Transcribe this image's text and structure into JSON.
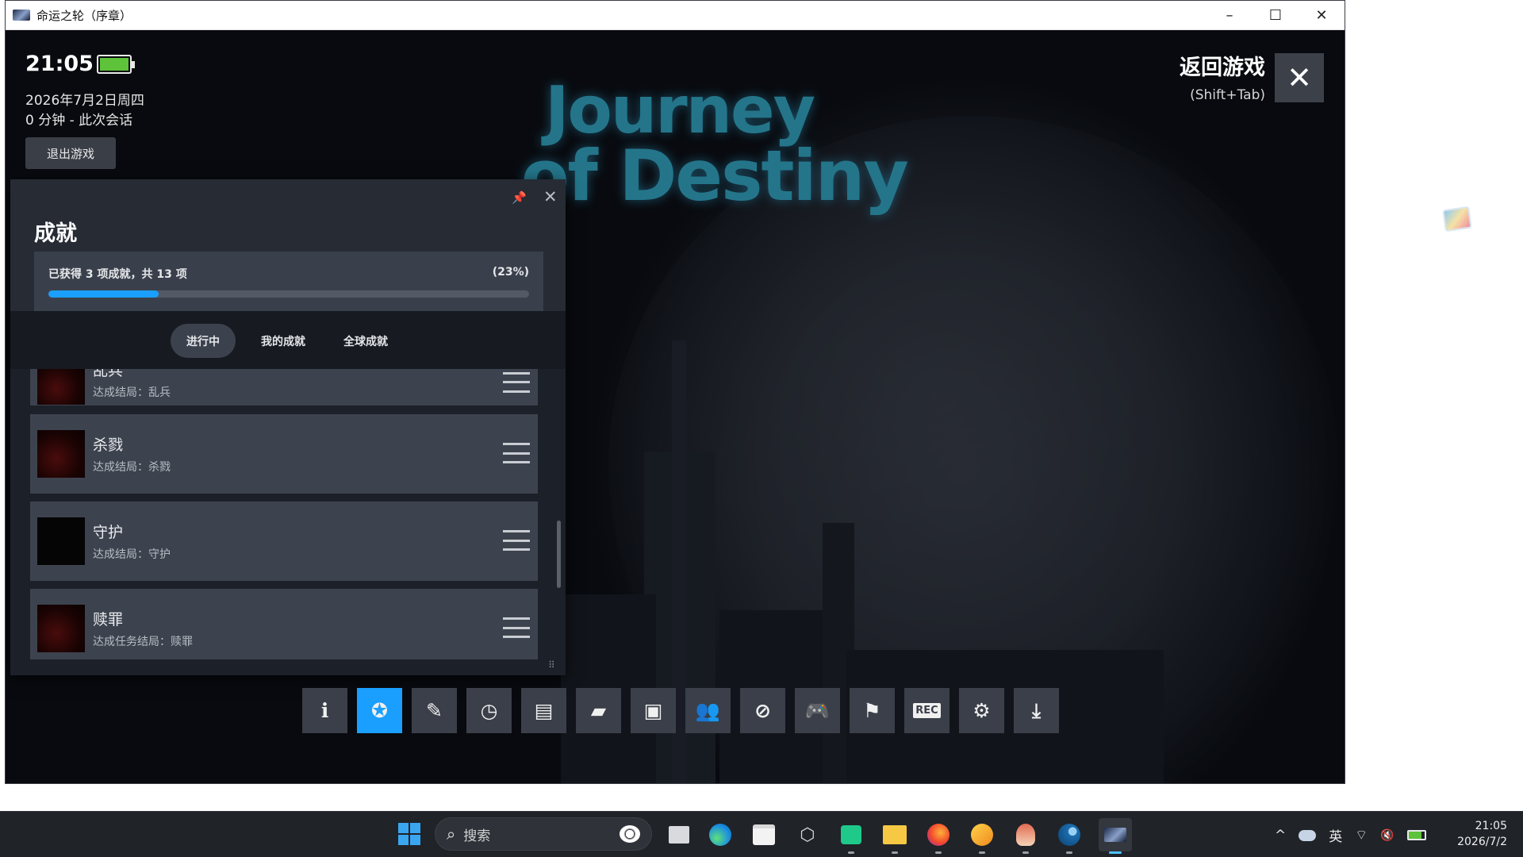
{
  "window": {
    "title": "命运之轮（序章）",
    "controls": {
      "minimize": "–",
      "maximize": "☐",
      "close": "✕"
    }
  },
  "game": {
    "title_line1": "Journey",
    "title_line2": "of Destiny"
  },
  "overlay": {
    "time": "21:05",
    "battery_level_percent": 100,
    "date": "2026年7月2日周四",
    "session": "0 分钟 - 此次会话",
    "exit_game": "退出游戏",
    "return_game": "返回游戏",
    "return_shortcut": "(Shift+Tab)",
    "close_icon": "✕"
  },
  "achievements": {
    "title": "成就",
    "progress_text": "已获得 3 项成就，共 13 项",
    "progress_percent_label": "(23%)",
    "progress_value": 23,
    "tabs": [
      {
        "label": "进行中",
        "active": true
      },
      {
        "label": "我的成就",
        "active": false
      },
      {
        "label": "全球成就",
        "active": false
      }
    ],
    "items": [
      {
        "name": "乱兵",
        "desc": "达成结局：乱兵"
      },
      {
        "name": "杀戮",
        "desc": "达成结局：杀戮"
      },
      {
        "name": "守护",
        "desc": "达成结局：守护"
      },
      {
        "name": "赎罪",
        "desc": "达成任务结局：赎罪"
      }
    ]
  },
  "toolbar": {
    "buttons": [
      {
        "icon": "info-icon",
        "glyph": "ℹ"
      },
      {
        "icon": "achievements-icon",
        "glyph": "✪",
        "active": true
      },
      {
        "icon": "notes-icon",
        "glyph": "✎"
      },
      {
        "icon": "timeline-icon",
        "glyph": "◷"
      },
      {
        "icon": "guides-icon",
        "glyph": "▤"
      },
      {
        "icon": "chat-icon",
        "glyph": "▰"
      },
      {
        "icon": "screenshots-icon",
        "glyph": "▣"
      },
      {
        "icon": "friends-icon",
        "glyph": "👥"
      },
      {
        "icon": "browser-icon",
        "glyph": "⊘"
      },
      {
        "icon": "controller-icon",
        "glyph": "🎮"
      },
      {
        "icon": "flag-icon",
        "glyph": "⚑"
      },
      {
        "icon": "record-icon",
        "glyph": "REC"
      },
      {
        "icon": "settings-icon",
        "glyph": "⚙"
      },
      {
        "icon": "download-icon",
        "glyph": "⤓"
      }
    ]
  },
  "taskbar": {
    "search_placeholder": "搜索",
    "tray_chevron": "^",
    "ime": "英",
    "wifi": "⌔",
    "volume": "🔇",
    "clock_time": "21:05",
    "clock_date": "2026/7/2"
  }
}
